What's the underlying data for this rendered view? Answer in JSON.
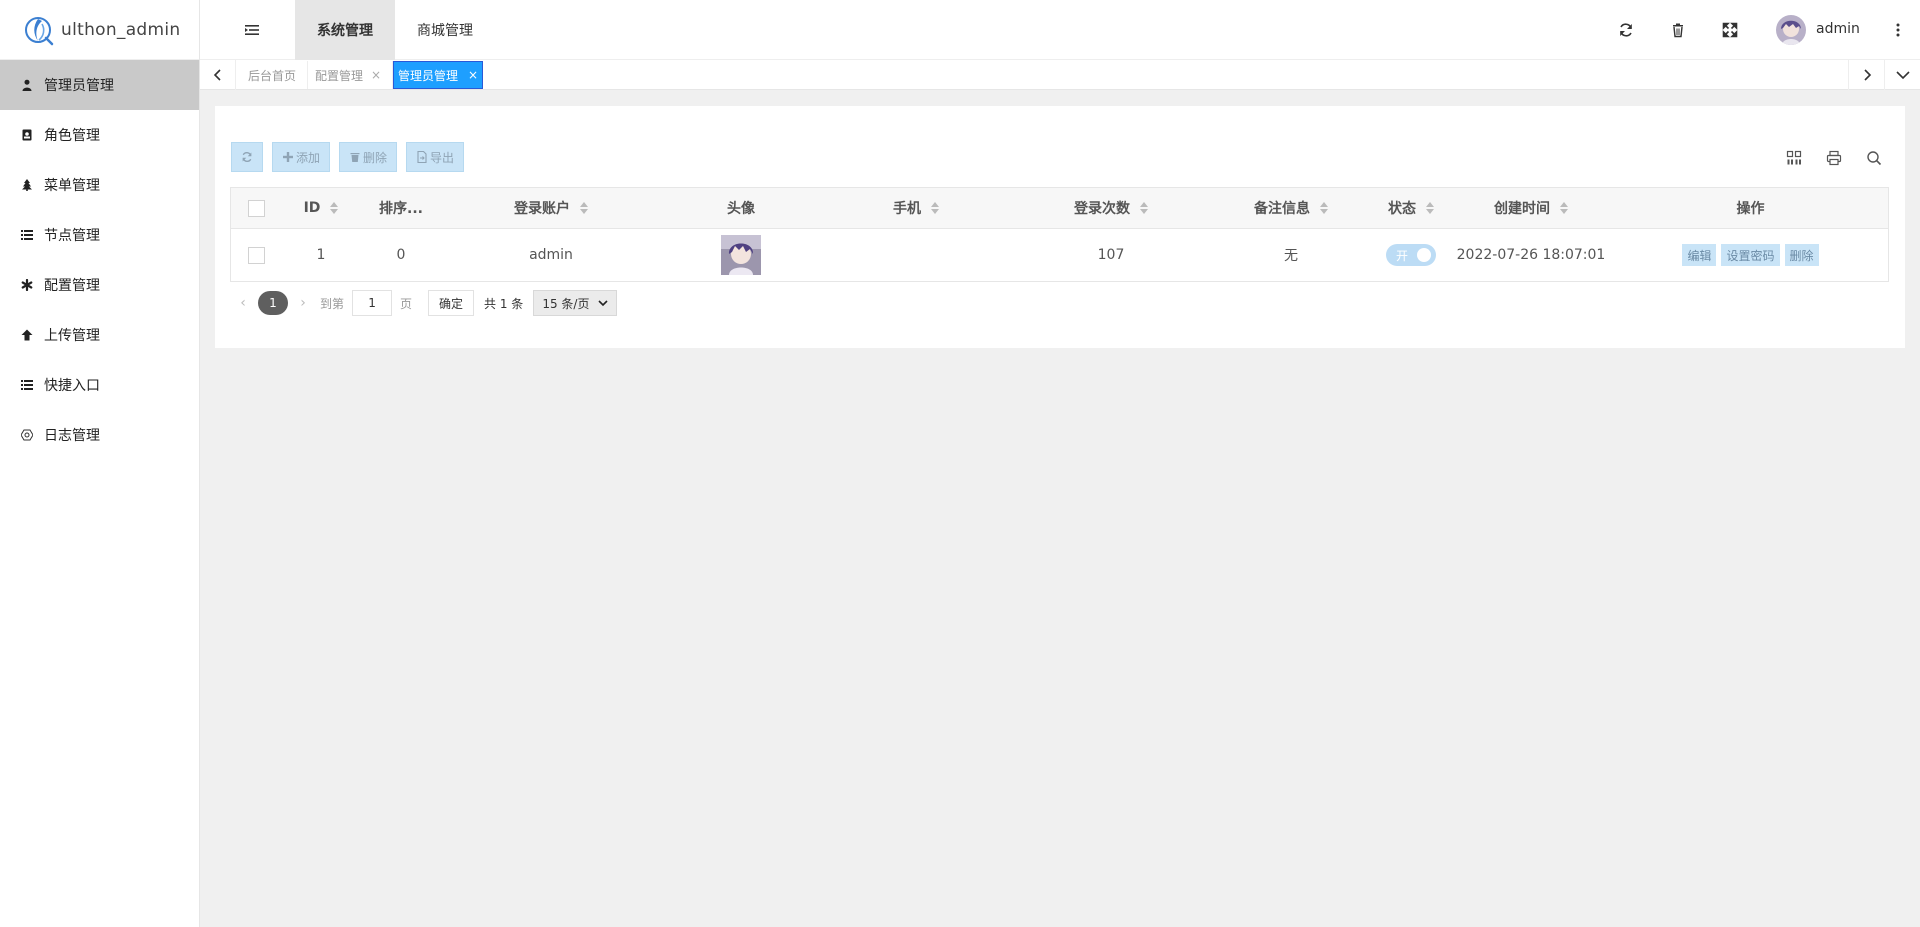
{
  "app": {
    "title": "ulthon_admin",
    "user": "admin"
  },
  "sidebar": {
    "items": [
      {
        "label": "管理员管理",
        "icon": "user-icon",
        "active": true
      },
      {
        "label": "角色管理",
        "icon": "id-badge-icon"
      },
      {
        "label": "菜单管理",
        "icon": "tree-icon"
      },
      {
        "label": "节点管理",
        "icon": "list-icon"
      },
      {
        "label": "配置管理",
        "icon": "asterisk-icon"
      },
      {
        "label": "上传管理",
        "icon": "arrow-up-icon"
      },
      {
        "label": "快捷入口",
        "icon": "list-icon"
      },
      {
        "label": "日志管理",
        "icon": "gear-outline-icon"
      }
    ]
  },
  "header": {
    "tabs": [
      {
        "label": "系统管理",
        "active": true
      },
      {
        "label": "商城管理"
      }
    ]
  },
  "page_tabs": {
    "items": [
      {
        "label": "后台首页"
      },
      {
        "label": "配置管理",
        "close": "×"
      },
      {
        "label": "管理员管理",
        "close": "×",
        "active": true
      }
    ]
  },
  "toolbar": {
    "add_label": "添加",
    "delete_label": "删除",
    "export_label": "导出"
  },
  "table": {
    "headers": {
      "id": "ID",
      "sort": "排序...",
      "account": "登录账户",
      "avatar": "头像",
      "phone": "手机",
      "login_count": "登录次数",
      "remark": "备注信息",
      "status": "状态",
      "created": "创建时间",
      "actions": "操作"
    },
    "rows": [
      {
        "id": "1",
        "sort": "0",
        "account": "admin",
        "phone": "",
        "login_count": "107",
        "remark": "无",
        "status_label": "开",
        "status_on": true,
        "created": "2022-07-26 18:07:01",
        "actions": {
          "edit": "编辑",
          "set_password": "设置密码",
          "delete": "删除"
        }
      }
    ]
  },
  "pager": {
    "current": "1",
    "goto_label": "到第",
    "goto_value": "1",
    "page_unit": "页",
    "confirm": "确定",
    "total": "共 1 条",
    "page_size": "15 条/页"
  },
  "colors": {
    "accent": "#1e9fff",
    "button_bg": "#c9e4f7",
    "sidebar_active": "#c9c9c9"
  }
}
